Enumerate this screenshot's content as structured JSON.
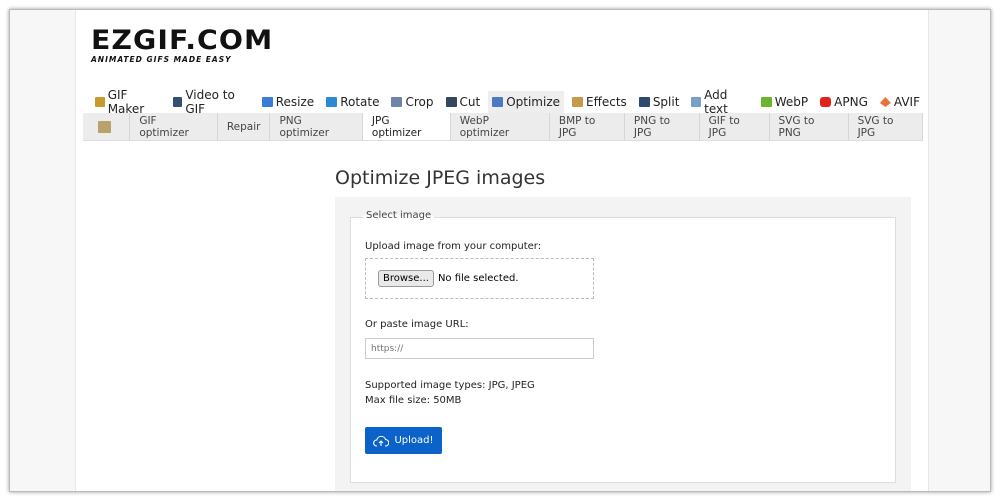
{
  "logo": {
    "title": "EZGIF.COM",
    "tagline": "ANIMATED GIFS MADE EASY"
  },
  "nav": [
    {
      "label": "GIF Maker",
      "icon": "gif-maker-icon",
      "color": "#c99a2e"
    },
    {
      "label": "Video to GIF",
      "icon": "video-icon",
      "color": "#34506e"
    },
    {
      "label": "Resize",
      "icon": "resize-icon",
      "color": "#3a7bd5"
    },
    {
      "label": "Rotate",
      "icon": "rotate-icon",
      "color": "#2a8ad3"
    },
    {
      "label": "Crop",
      "icon": "crop-icon",
      "color": "#6b84a8"
    },
    {
      "label": "Cut",
      "icon": "cut-icon",
      "color": "#33475e"
    },
    {
      "label": "Optimize",
      "icon": "optimize-icon",
      "color": "#4c7ac0"
    },
    {
      "label": "Effects",
      "icon": "effects-icon",
      "color": "#c79a4a"
    },
    {
      "label": "Split",
      "icon": "split-icon",
      "color": "#2f4a6c"
    },
    {
      "label": "Add text",
      "icon": "add-text-icon",
      "color": "#7aa0c8"
    },
    {
      "label": "WebP",
      "icon": "webp-icon",
      "color": "#6bb52e"
    },
    {
      "label": "APNG",
      "icon": "apng-icon",
      "color": "#e0241c"
    },
    {
      "label": "AVIF",
      "icon": "avif-icon",
      "color": "#e8733a"
    }
  ],
  "subnav": [
    "GIF optimizer",
    "Repair",
    "PNG optimizer",
    "JPG optimizer",
    "WebP optimizer",
    "BMP to JPG",
    "PNG to JPG",
    "GIF to JPG",
    "SVG to PNG",
    "SVG to JPG"
  ],
  "main": {
    "title": "Optimize JPEG images",
    "legend": "Select image",
    "upload_label": "Upload image from your computer:",
    "browse": "Browse...",
    "no_file": "No file selected.",
    "url_label": "Or paste image URL:",
    "url_placeholder": "https://",
    "supported": "Supported image types: JPG, JPEG",
    "max_size": "Max file size: 50MB",
    "upload_button": "Upload!"
  }
}
